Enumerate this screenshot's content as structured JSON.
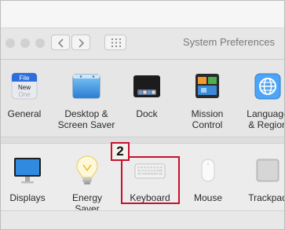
{
  "window": {
    "title": "System Preferences"
  },
  "toolbar": {
    "back_icon": "chevron-left-icon",
    "forward_icon": "chevron-right-icon",
    "show_all_icon": "grid-icon"
  },
  "row1": [
    {
      "label": "General",
      "icon": "general-icon",
      "file_text": "File",
      "new_text": "New",
      "one_text": "One"
    },
    {
      "label": "Desktop &\nScreen Saver",
      "icon": "desktop-screen-saver-icon"
    },
    {
      "label": "Dock",
      "icon": "dock-icon"
    },
    {
      "label": "Mission\nControl",
      "icon": "mission-control-icon"
    },
    {
      "label": "Language\n& Region",
      "icon": "language-region-icon"
    }
  ],
  "row2": [
    {
      "label": "Displays",
      "icon": "displays-icon"
    },
    {
      "label": "Energy\nSaver",
      "icon": "energy-saver-icon"
    },
    {
      "label": "Keyboard",
      "icon": "keyboard-icon"
    },
    {
      "label": "Mouse",
      "icon": "mouse-icon"
    },
    {
      "label": "Trackpad",
      "icon": "trackpad-icon"
    }
  ],
  "annotation": {
    "step_number": "2",
    "highlight_color": "#c8102e"
  }
}
